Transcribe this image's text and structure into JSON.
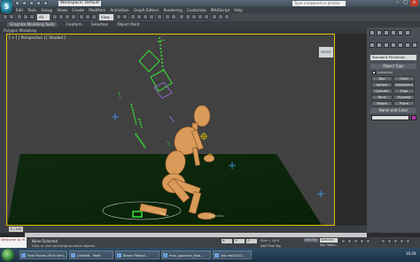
{
  "titlebar": {
    "workspace": "Workspace: Default",
    "search_placeholder": "Type a keyword or phrase"
  },
  "menu": [
    "Edit",
    "Tools",
    "Group",
    "Views",
    "Create",
    "Modifiers",
    "Animation",
    "Graph Editors",
    "Rendering",
    "Customize",
    "MAXScript",
    "Help"
  ],
  "toolbar": {
    "selection_filter": "All",
    "view_select": "View"
  },
  "ribbon": {
    "tabs": [
      "Graphite Modeling Tools",
      "Freeform",
      "Selection",
      "Object Paint"
    ],
    "panel_label": "Polygon Modeling"
  },
  "viewport": {
    "label": "[ + ] [ Perspective ] [ Shaded ]",
    "viewcube": "FRONT"
  },
  "command_panel": {
    "category_select": "Standard Primitives",
    "object_type_header": "Object Type",
    "autogrid_label": "AutoGrid",
    "buttons": [
      "Box",
      "Cone",
      "Sphere",
      "GeoSphere",
      "Cylinder",
      "Tube",
      "Torus",
      "Pyramid",
      "Teapot",
      "Plane"
    ],
    "name_color_header": "Name and Color"
  },
  "timeline": {
    "time_thumb": "0 / 100"
  },
  "status": {
    "maxscript_lines": [
      "Welcome to M"
    ],
    "status_text": "None Selected",
    "prompt_text": "Click or click-and-drag to select objects",
    "coord_x": "X:",
    "coord_y": "Y:",
    "coord_z": "Z:",
    "grid": "Grid = 10.0",
    "add_time_tag": "Add Time Tag",
    "autokey": "Auto Key",
    "setkey_select": "Selected",
    "key_filters": "Key Filters..."
  },
  "taskbar": {
    "items": [
      "Final Moves (Final Vers...",
      "Untitled - Paint",
      "Blazer Reload...",
      "max_uppercut_final...",
      "3ds max2012..."
    ],
    "clock": "16:29"
  },
  "colors": {
    "viewport_bg": "#414141",
    "ground": "#0b1f0b",
    "character": "#d99a5a",
    "controllers": "#36e036",
    "active_border": "#e0c000"
  }
}
